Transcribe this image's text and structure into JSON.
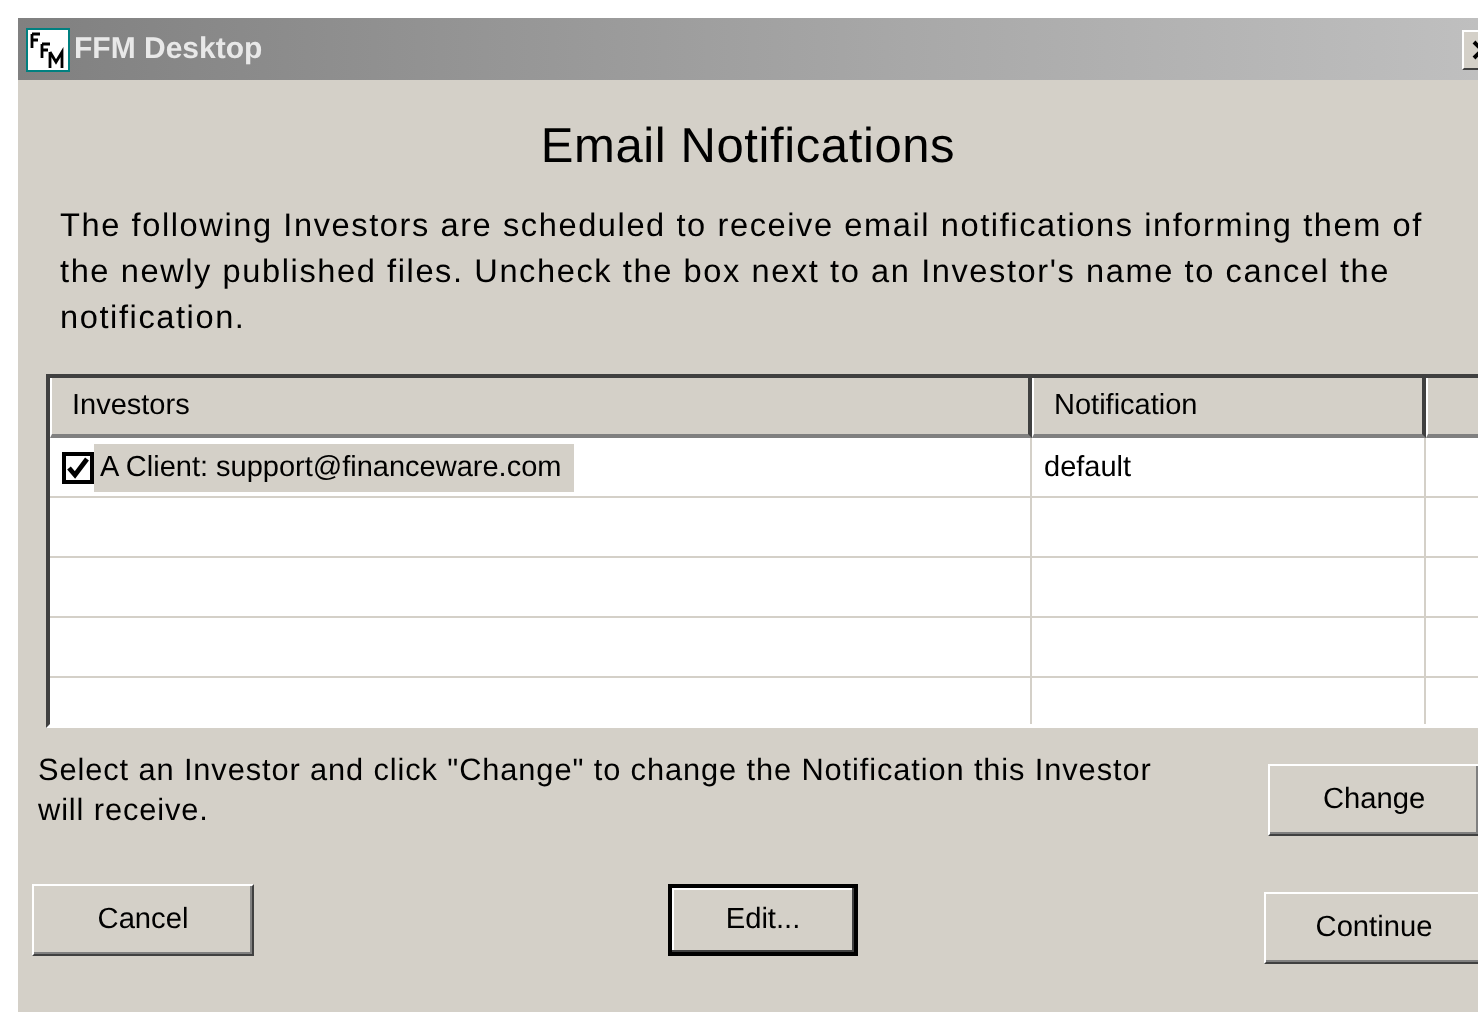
{
  "window": {
    "title": "FFM Desktop"
  },
  "heading": "Email Notifications",
  "intro": "The following Investors are scheduled to receive email notifications informing them of the newly published files. Uncheck the box next to an Investor's name to cancel the notification.",
  "table": {
    "columns": [
      "Investors",
      "Notification"
    ],
    "rows": [
      {
        "investor": "A Client: support@financeware.com",
        "notification": "default",
        "checked": true,
        "selected": true
      }
    ]
  },
  "hint": "Select an Investor and click \"Change\" to change the Notification this Investor will receive.",
  "buttons": [
    {
      "label": "Change",
      "kind": "change",
      "default": false
    },
    {
      "label": "Cancel",
      "kind": "cancel",
      "default": false
    },
    {
      "label": "Edit...",
      "kind": "edit",
      "default": true
    },
    {
      "label": "Continue",
      "kind": "continue",
      "default": false
    }
  ]
}
